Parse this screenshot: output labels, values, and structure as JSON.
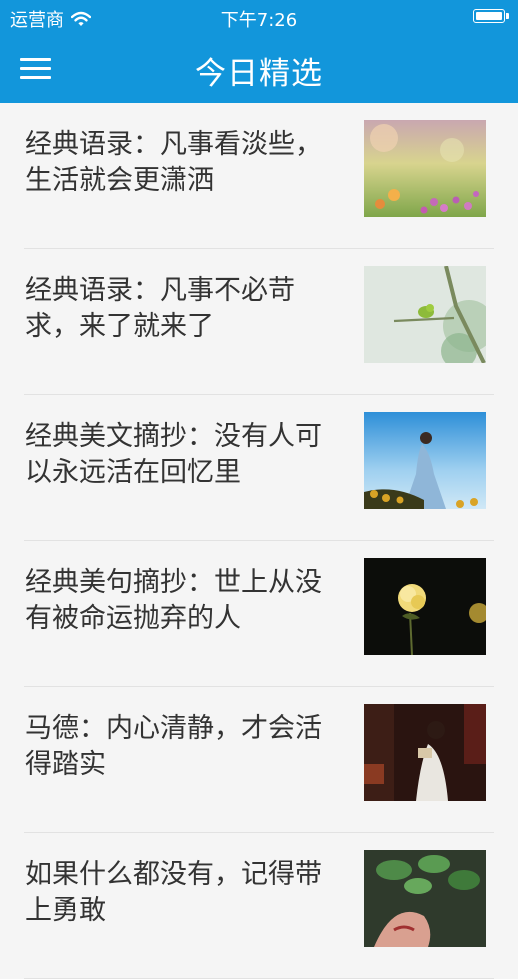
{
  "status_bar": {
    "carrier": "运营商",
    "time": "下午7:26"
  },
  "nav": {
    "title": "今日精选",
    "menu_icon": "hamburger-menu-icon"
  },
  "articles": [
    {
      "title": "经典语录：凡事看淡些，生活就会更潇洒",
      "thumbnail": "flowers-field-photo"
    },
    {
      "title": "经典语录：凡事不必苛求，来了就来了",
      "thumbnail": "bird-on-branch-photo"
    },
    {
      "title": "经典美文摘抄：没有人可以永远活在回忆里",
      "thumbnail": "woman-in-sunflower-field-photo"
    },
    {
      "title": "经典美句摘抄：世上从没有被命运抛弃的人",
      "thumbnail": "yellow-rose-night-photo"
    },
    {
      "title": "马德：内心清静，才会活得踏实",
      "thumbnail": "woman-reading-photo"
    },
    {
      "title": "如果什么都没有，记得带上勇敢",
      "thumbnail": "woman-with-leaves-photo"
    }
  ]
}
